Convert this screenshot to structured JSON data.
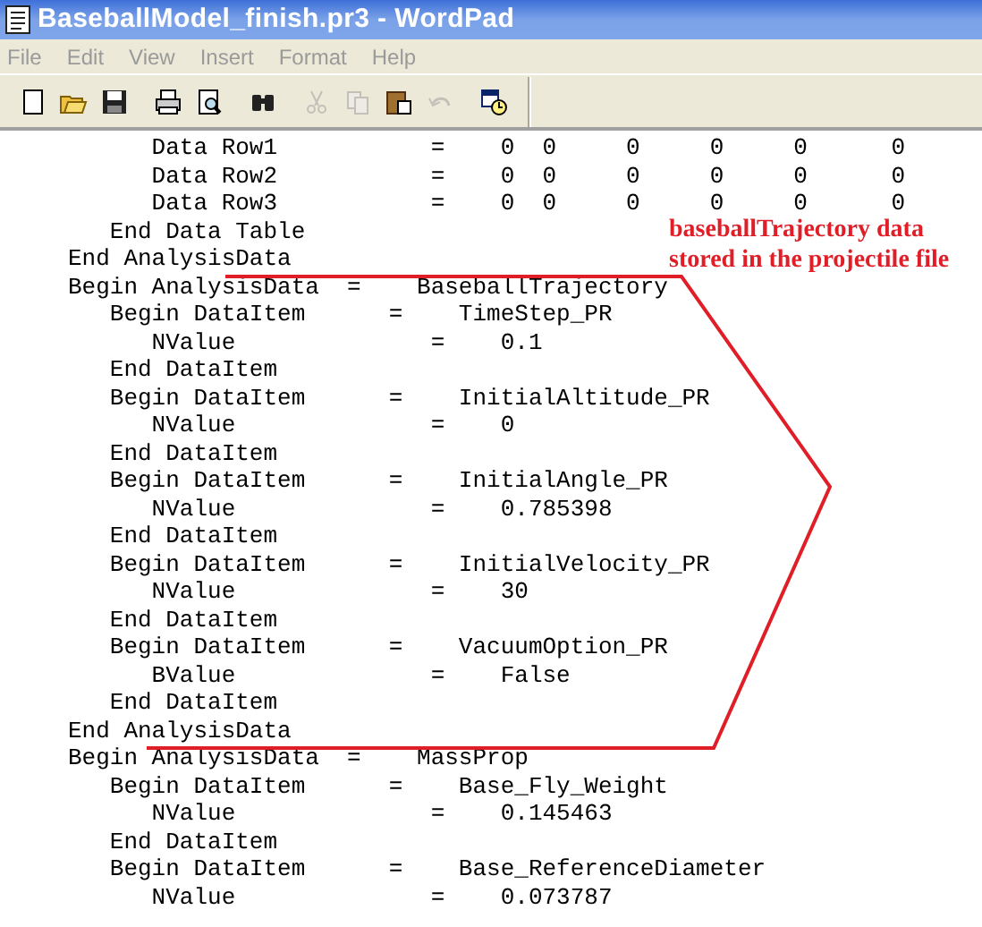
{
  "window": {
    "title": "BaseballModel_finish.pr3 - WordPad"
  },
  "menu": [
    {
      "label": "File"
    },
    {
      "label": "Edit"
    },
    {
      "label": "View"
    },
    {
      "label": "Insert"
    },
    {
      "label": "Format"
    },
    {
      "label": "Help"
    }
  ],
  "toolbar": [
    {
      "kind": "new",
      "disabled": false
    },
    {
      "kind": "open",
      "disabled": false
    },
    {
      "kind": "save",
      "disabled": false
    },
    {
      "kind": "separator"
    },
    {
      "kind": "print",
      "disabled": false
    },
    {
      "kind": "preview",
      "disabled": false
    },
    {
      "kind": "separator"
    },
    {
      "kind": "find",
      "disabled": false
    },
    {
      "kind": "separator"
    },
    {
      "kind": "cut",
      "disabled": true
    },
    {
      "kind": "copy",
      "disabled": true
    },
    {
      "kind": "paste",
      "disabled": false
    },
    {
      "kind": "undo",
      "disabled": true
    },
    {
      "kind": "separator"
    },
    {
      "kind": "datetime",
      "disabled": false
    }
  ],
  "document": {
    "lines": [
      "      Data Row1           =    0  0     0     0     0      0",
      "      Data Row2           =    0  0     0     0     0      0",
      "      Data Row3           =    0  0     0     0     0      0",
      "   End Data Table",
      "End AnalysisData",
      "Begin AnalysisData  =    BaseballTrajectory",
      "   Begin DataItem      =    TimeStep_PR",
      "      NValue              =    0.1",
      "   End DataItem",
      "   Begin DataItem      =    InitialAltitude_PR",
      "      NValue              =    0",
      "   End DataItem",
      "   Begin DataItem      =    InitialAngle_PR",
      "      NValue              =    0.785398",
      "   End DataItem",
      "   Begin DataItem      =    InitialVelocity_PR",
      "      NValue              =    30",
      "   End DataItem",
      "   Begin DataItem      =    VacuumOption_PR",
      "      BValue              =    False",
      "   End DataItem",
      "End AnalysisData",
      "Begin AnalysisData  =    MassProp",
      "   Begin DataItem      =    Base_Fly_Weight",
      "      NValue              =    0.145463",
      "   End DataItem",
      "   Begin DataItem      =    Base_ReferenceDiameter",
      "      NValue              =    0.073787"
    ]
  },
  "annotation": {
    "lines": [
      "baseballTrajectory data",
      "stored in the projectile file"
    ]
  }
}
